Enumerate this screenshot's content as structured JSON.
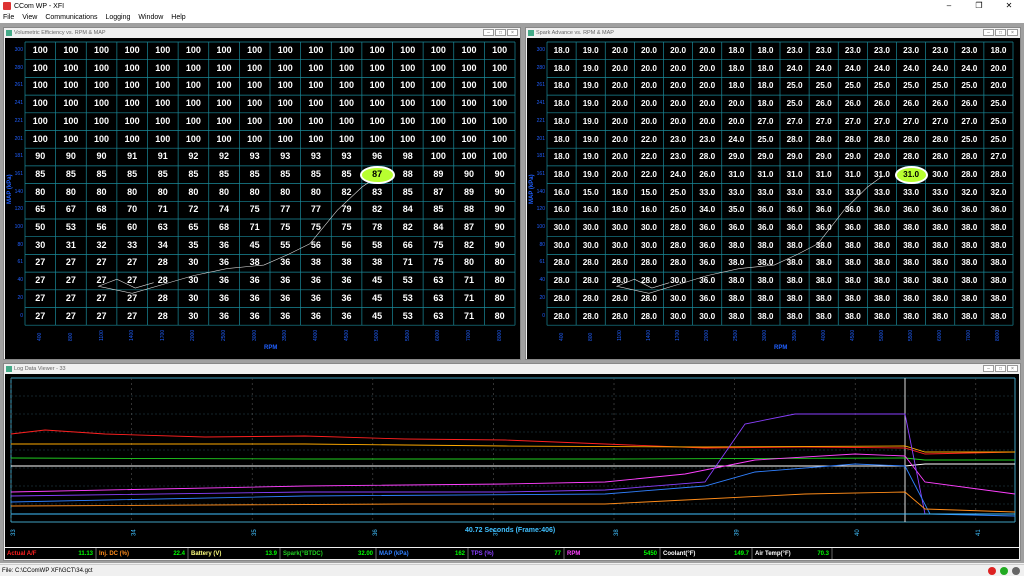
{
  "app": {
    "title": "CCom WP - XFI"
  },
  "menu": [
    "File",
    "View",
    "Communications",
    "Logging",
    "Window",
    "Help"
  ],
  "ve": {
    "title": "Volumetric Efficiency vs. RPM & MAP",
    "ylabel": "MAP (kPa)",
    "xlabel": "RPM",
    "map_ticks": [
      "300",
      "280",
      "261",
      "241",
      "221",
      "201",
      "181",
      "161",
      "140",
      "120",
      "100",
      "80",
      "61",
      "40",
      "20",
      "0"
    ],
    "rpm_ticks": [
      "400",
      "800",
      "1100",
      "1400",
      "1700",
      "2000",
      "2500",
      "3000",
      "3500",
      "4000",
      "4500",
      "5000",
      "5500",
      "6000",
      "7000",
      "8000"
    ],
    "rows": [
      [
        "100",
        "100",
        "100",
        "100",
        "100",
        "100",
        "100",
        "100",
        "100",
        "100",
        "100",
        "100",
        "100",
        "100",
        "100",
        "100"
      ],
      [
        "100",
        "100",
        "100",
        "100",
        "100",
        "100",
        "100",
        "100",
        "100",
        "100",
        "100",
        "100",
        "100",
        "100",
        "100",
        "100"
      ],
      [
        "100",
        "100",
        "100",
        "100",
        "100",
        "100",
        "100",
        "100",
        "100",
        "100",
        "100",
        "100",
        "100",
        "100",
        "100",
        "100"
      ],
      [
        "100",
        "100",
        "100",
        "100",
        "100",
        "100",
        "100",
        "100",
        "100",
        "100",
        "100",
        "100",
        "100",
        "100",
        "100",
        "100"
      ],
      [
        "100",
        "100",
        "100",
        "100",
        "100",
        "100",
        "100",
        "100",
        "100",
        "100",
        "100",
        "100",
        "100",
        "100",
        "100",
        "100"
      ],
      [
        "100",
        "100",
        "100",
        "100",
        "100",
        "100",
        "100",
        "100",
        "100",
        "100",
        "100",
        "100",
        "100",
        "100",
        "100",
        "100"
      ],
      [
        "90",
        "90",
        "90",
        "91",
        "91",
        "92",
        "92",
        "93",
        "93",
        "93",
        "93",
        "96",
        "98",
        "100",
        "100",
        "100"
      ],
      [
        "85",
        "85",
        "85",
        "85",
        "85",
        "85",
        "85",
        "85",
        "85",
        "85",
        "85",
        "87",
        "88",
        "89",
        "90",
        "90"
      ],
      [
        "80",
        "80",
        "80",
        "80",
        "80",
        "80",
        "80",
        "80",
        "80",
        "80",
        "82",
        "83",
        "85",
        "87",
        "89",
        "90"
      ],
      [
        "65",
        "67",
        "68",
        "70",
        "71",
        "72",
        "74",
        "75",
        "77",
        "77",
        "79",
        "82",
        "84",
        "85",
        "88",
        "90"
      ],
      [
        "50",
        "53",
        "56",
        "60",
        "63",
        "65",
        "68",
        "71",
        "75",
        "75",
        "75",
        "78",
        "82",
        "84",
        "87",
        "90"
      ],
      [
        "30",
        "31",
        "32",
        "33",
        "34",
        "35",
        "36",
        "45",
        "55",
        "56",
        "56",
        "58",
        "66",
        "75",
        "82",
        "90"
      ],
      [
        "27",
        "27",
        "27",
        "27",
        "28",
        "30",
        "36",
        "38",
        "36",
        "38",
        "38",
        "38",
        "71",
        "75",
        "80",
        "80"
      ],
      [
        "27",
        "27",
        "27",
        "27",
        "28",
        "30",
        "36",
        "36",
        "36",
        "36",
        "36",
        "45",
        "53",
        "63",
        "71",
        "80"
      ],
      [
        "27",
        "27",
        "27",
        "27",
        "28",
        "30",
        "36",
        "36",
        "36",
        "36",
        "36",
        "45",
        "53",
        "63",
        "71",
        "80"
      ],
      [
        "27",
        "27",
        "27",
        "27",
        "28",
        "30",
        "36",
        "36",
        "36",
        "36",
        "36",
        "45",
        "53",
        "63",
        "71",
        "80"
      ]
    ],
    "highlight": {
      "row": 7,
      "col": 11,
      "value": "87"
    }
  },
  "spark": {
    "title": "Spark Advance vs. RPM & MAP",
    "ylabel": "MAP (kPa)",
    "xlabel": "RPM",
    "map_ticks": [
      "300",
      "280",
      "261",
      "241",
      "221",
      "201",
      "181",
      "161",
      "140",
      "120",
      "100",
      "80",
      "61",
      "40",
      "20",
      "0"
    ],
    "rpm_ticks": [
      "400",
      "800",
      "1100",
      "1400",
      "1700",
      "2000",
      "2500",
      "3000",
      "3500",
      "4000",
      "4500",
      "5000",
      "5500",
      "6000",
      "7000",
      "8000"
    ],
    "rows": [
      [
        "18.0",
        "19.0",
        "20.0",
        "20.0",
        "20.0",
        "20.0",
        "18.0",
        "18.0",
        "23.0",
        "23.0",
        "23.0",
        "23.0",
        "23.0",
        "23.0",
        "23.0",
        "18.0"
      ],
      [
        "18.0",
        "19.0",
        "20.0",
        "20.0",
        "20.0",
        "20.0",
        "18.0",
        "18.0",
        "24.0",
        "24.0",
        "24.0",
        "24.0",
        "24.0",
        "24.0",
        "24.0",
        "20.0"
      ],
      [
        "18.0",
        "19.0",
        "20.0",
        "20.0",
        "20.0",
        "20.0",
        "18.0",
        "18.0",
        "25.0",
        "25.0",
        "25.0",
        "25.0",
        "25.0",
        "25.0",
        "25.0",
        "20.0"
      ],
      [
        "18.0",
        "19.0",
        "20.0",
        "20.0",
        "20.0",
        "20.0",
        "20.0",
        "18.0",
        "25.0",
        "26.0",
        "26.0",
        "26.0",
        "26.0",
        "26.0",
        "26.0",
        "25.0"
      ],
      [
        "18.0",
        "19.0",
        "20.0",
        "20.0",
        "20.0",
        "20.0",
        "20.0",
        "27.0",
        "27.0",
        "27.0",
        "27.0",
        "27.0",
        "27.0",
        "27.0",
        "27.0",
        "25.0"
      ],
      [
        "18.0",
        "19.0",
        "20.0",
        "22.0",
        "23.0",
        "23.0",
        "24.0",
        "25.0",
        "28.0",
        "28.0",
        "28.0",
        "28.0",
        "28.0",
        "28.0",
        "25.0",
        "25.0"
      ],
      [
        "18.0",
        "19.0",
        "20.0",
        "22.0",
        "23.0",
        "28.0",
        "29.0",
        "29.0",
        "29.0",
        "29.0",
        "29.0",
        "29.0",
        "28.0",
        "28.0",
        "28.0",
        "27.0"
      ],
      [
        "18.0",
        "19.0",
        "20.0",
        "22.0",
        "24.0",
        "26.0",
        "31.0",
        "31.0",
        "31.0",
        "31.0",
        "31.0",
        "31.0",
        "31.0",
        "30.0",
        "28.0",
        "28.0"
      ],
      [
        "16.0",
        "15.0",
        "18.0",
        "15.0",
        "25.0",
        "33.0",
        "33.0",
        "33.0",
        "33.0",
        "33.0",
        "33.0",
        "33.0",
        "33.0",
        "33.0",
        "32.0",
        "32.0"
      ],
      [
        "16.0",
        "16.0",
        "18.0",
        "16.0",
        "25.0",
        "34.0",
        "35.0",
        "36.0",
        "36.0",
        "36.0",
        "36.0",
        "36.0",
        "36.0",
        "36.0",
        "36.0",
        "36.0"
      ],
      [
        "30.0",
        "30.0",
        "30.0",
        "30.0",
        "28.0",
        "36.0",
        "36.0",
        "36.0",
        "36.0",
        "36.0",
        "36.0",
        "38.0",
        "38.0",
        "38.0",
        "38.0",
        "38.0"
      ],
      [
        "30.0",
        "30.0",
        "30.0",
        "30.0",
        "28.0",
        "36.0",
        "38.0",
        "38.0",
        "38.0",
        "38.0",
        "38.0",
        "38.0",
        "38.0",
        "38.0",
        "38.0",
        "38.0"
      ],
      [
        "28.0",
        "28.0",
        "28.0",
        "28.0",
        "28.0",
        "36.0",
        "38.0",
        "38.0",
        "38.0",
        "38.0",
        "38.0",
        "38.0",
        "38.0",
        "38.0",
        "38.0",
        "38.0"
      ],
      [
        "28.0",
        "28.0",
        "28.0",
        "28.0",
        "30.0",
        "36.0",
        "38.0",
        "38.0",
        "38.0",
        "38.0",
        "38.0",
        "38.0",
        "38.0",
        "38.0",
        "38.0",
        "38.0"
      ],
      [
        "28.0",
        "28.0",
        "28.0",
        "28.0",
        "30.0",
        "36.0",
        "38.0",
        "38.0",
        "38.0",
        "38.0",
        "38.0",
        "38.0",
        "38.0",
        "38.0",
        "38.0",
        "38.0"
      ],
      [
        "28.0",
        "28.0",
        "28.0",
        "28.0",
        "30.0",
        "30.0",
        "38.0",
        "38.0",
        "38.0",
        "38.0",
        "38.0",
        "38.0",
        "38.0",
        "38.0",
        "38.0",
        "38.0"
      ]
    ],
    "highlight": {
      "row": 7,
      "col": 12,
      "value": "31.0"
    }
  },
  "log": {
    "title": "Log Data Viewer - 33",
    "time_label": "40.72 Seconds (Frame:406)",
    "x_ticks": [
      "33",
      "34",
      "35",
      "36",
      "37",
      "38",
      "39",
      "40",
      "41"
    ],
    "legend": [
      {
        "name": "Actual A/F",
        "value": "11.13",
        "color": "#ff2020"
      },
      {
        "name": "Inj. DC (%)",
        "value": "22.4",
        "color": "#ff8c1a"
      },
      {
        "name": "Battery (V)",
        "value": "13.9",
        "color": "#ffff80"
      },
      {
        "name": "Spark(°BTDC)",
        "value": "32.00",
        "color": "#20d020"
      },
      {
        "name": "MAP (kPa)",
        "value": "162",
        "color": "#3080ff"
      },
      {
        "name": "TPS (%)",
        "value": "77",
        "color": "#8a40ff"
      },
      {
        "name": "RPM",
        "value": "5450",
        "color": "#ff40ff"
      },
      {
        "name": "Coolant(°F)",
        "value": "149.7",
        "color": "#ffffff"
      },
      {
        "name": "Air Temp(°F)",
        "value": "70.3",
        "color": "#ffffff"
      }
    ]
  },
  "status": {
    "file": "File: C:\\CComWP XFI\\GCT\\34.gct"
  }
}
